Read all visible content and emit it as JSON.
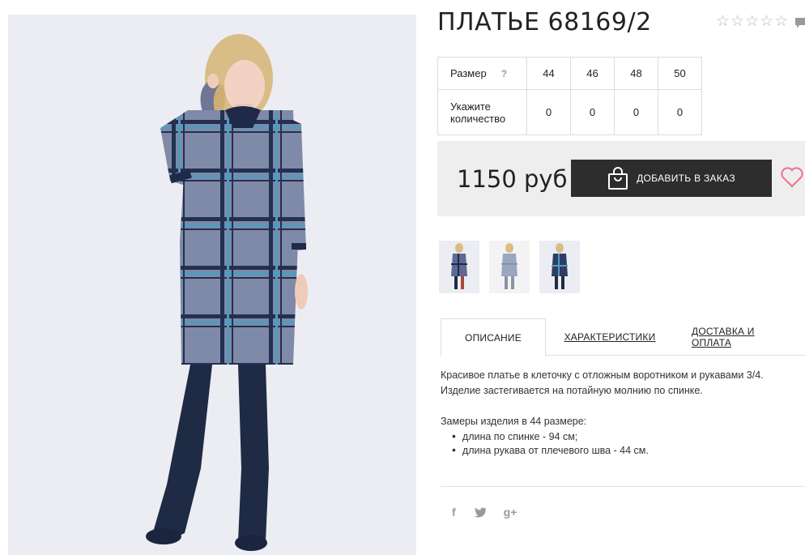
{
  "product": {
    "title": "ПЛАТЬЕ 68169/2",
    "rating_stars": 5,
    "rating_value": 0
  },
  "sizes": {
    "size_label": "Размер",
    "help_icon": "?",
    "qty_label_line1": "Укажите",
    "qty_label_line2": "количество",
    "options": [
      {
        "size": "44",
        "qty": "0"
      },
      {
        "size": "46",
        "qty": "0"
      },
      {
        "size": "48",
        "qty": "0"
      },
      {
        "size": "50",
        "qty": "0"
      }
    ]
  },
  "buy": {
    "price": "1150 руб",
    "order_button": "ДОБАВИТЬ В ЗАКАЗ",
    "accent_color": "#e8728a",
    "button_color": "#2d2d2d"
  },
  "tabs": [
    {
      "label": "ОПИСАНИЕ",
      "active": true
    },
    {
      "label": "ХАРАКТЕРИСТИКИ",
      "active": false
    },
    {
      "label": "ДОСТАВКА И ОПЛАТА",
      "active": false
    }
  ],
  "description": {
    "line1": "Красивое платье в клеточку с отложным воротником и рукавами 3/4.",
    "line2": "Изделие застегивается на потайную молнию по спинке.",
    "measure_title": "Замеры изделия в 44 размере:",
    "items": [
      "длина по спинке - 94 см;",
      "длина рукава от плечевого шва - 44 см."
    ]
  },
  "social": {
    "facebook": "f",
    "twitter": "twitter-icon",
    "google": "g+"
  },
  "icons": {
    "bag": "shopping-bag-icon",
    "heart": "heart-icon",
    "star": "star-icon",
    "comment": "comment-icon"
  }
}
